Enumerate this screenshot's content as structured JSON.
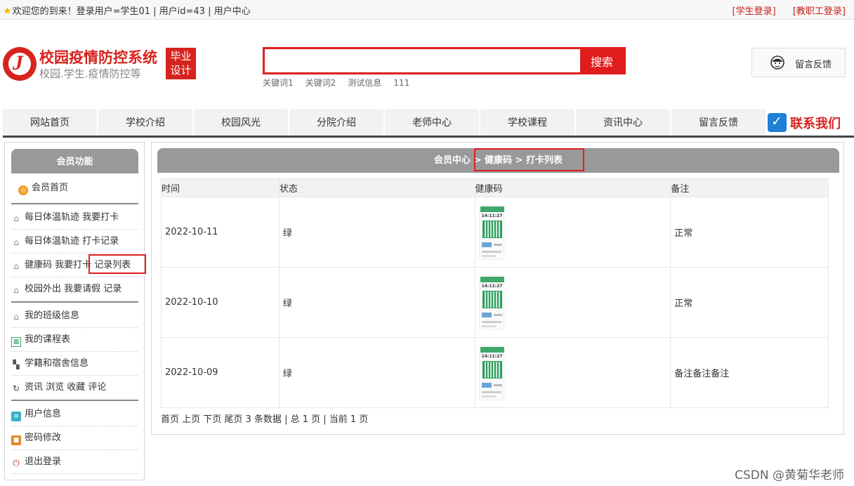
{
  "topbar": {
    "welcome": "欢迎您的到来！登录用户=学生01 | 用户id=43 | 用户中心",
    "student_login": "[学生登录]",
    "staff_login": "[教职工登录]"
  },
  "header": {
    "logo_title": "校园疫情防控系统",
    "logo_sub": "校园.学生.疫情防控等",
    "logo_badge_line1": "毕业",
    "logo_badge_line2": "设计",
    "search_value": "",
    "search_button": "搜索",
    "keywords": [
      "关键词1",
      "关键词2",
      "测试信息",
      "111"
    ],
    "feedback": "留言反馈"
  },
  "nav": {
    "items": [
      "网站首页",
      "学校介绍",
      "校园风光",
      "分院介绍",
      "老师中心",
      "学校课程",
      "资讯中心",
      "留言反馈"
    ],
    "contact": "联系我们"
  },
  "sidebar": {
    "title": "会员功能",
    "home": "会员首页",
    "items": [
      "每日体温轨迹 我要打卡",
      "每日体温轨迹 打卡记录",
      "健康码 我要打卡 记录列表",
      "校园外出 我要请假 记录",
      "我的班级信息",
      "我的课程表",
      "学籍和宿舍信息",
      "资讯 浏览 收藏 评论",
      "用户信息",
      "密码修改",
      "退出登录"
    ]
  },
  "main": {
    "breadcrumb": "会员中心 > 健康码 > 打卡列表",
    "columns": [
      "时间",
      "状态",
      "健康码",
      "备注"
    ],
    "rows": [
      {
        "date": "2022-10-11",
        "status": "绿",
        "note": "正常",
        "qr_time": "14:11:27"
      },
      {
        "date": "2022-10-10",
        "status": "绿",
        "note": "正常",
        "qr_time": "14:11:27"
      },
      {
        "date": "2022-10-09",
        "status": "绿",
        "note": "备注备注备注",
        "qr_time": "14:11:27"
      }
    ],
    "pager": "首页 上页 下页 尾页 3 条数据 | 总 1 页 | 当前 1 页"
  },
  "watermark": "CSDN @黄菊华老师",
  "colors": {
    "brand_red": "#d6231e",
    "accent_red": "#e01d1d",
    "header_gray": "#999999",
    "qr_green": "#3da86a"
  }
}
